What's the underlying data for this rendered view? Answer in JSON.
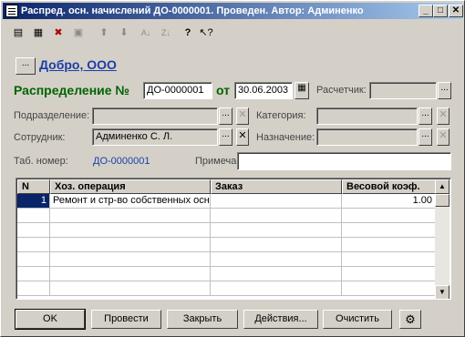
{
  "window": {
    "title": "Распред. осн. начислений ДО-0000001. Проведен. Автор: Админенко"
  },
  "title_buttons": {
    "minimize": "_",
    "maximize": "□",
    "close": "✕"
  },
  "toolbar": {
    "icons": [
      "new-row-icon",
      "copy-row-icon",
      "delete-row-icon",
      "edit-row-icon",
      "move-up-icon",
      "move-down-icon",
      "sort-asc-icon",
      "sort-desc-icon",
      "help-icon",
      "context-help-icon"
    ]
  },
  "header": {
    "org_button": "...",
    "org_name": "Добро, ООО",
    "doc_label": "Распределение №",
    "doc_number": "ДО-0000001",
    "date_label": "от",
    "date_value": "30.06.2003",
    "payer_label": "Расчетчик:",
    "payer_value": ""
  },
  "fields": {
    "department_label": "Подразделение:",
    "department_value": "",
    "category_label": "Категория:",
    "category_value": "",
    "employee_label": "Сотрудник:",
    "employee_value": "Админенко С. Л.",
    "purpose_label": "Назначение:",
    "purpose_value": "",
    "tab_label": "Таб. номер:",
    "tab_value": "ДО-0000001",
    "note_label": "Примечание:",
    "note_value": "",
    "choose_glyph": "...",
    "clear_glyph": "✕"
  },
  "table": {
    "columns": [
      "N",
      "Хоз. операция",
      "Заказ",
      "Весовой коэф."
    ],
    "rows": [
      [
        "1",
        "Ремонт и стр-во собственных осн",
        "",
        "1.00"
      ]
    ]
  },
  "buttons": {
    "ok": "OK",
    "post": "Провести",
    "close": "Закрыть",
    "actions": "Действия...",
    "clear": "Очистить"
  }
}
